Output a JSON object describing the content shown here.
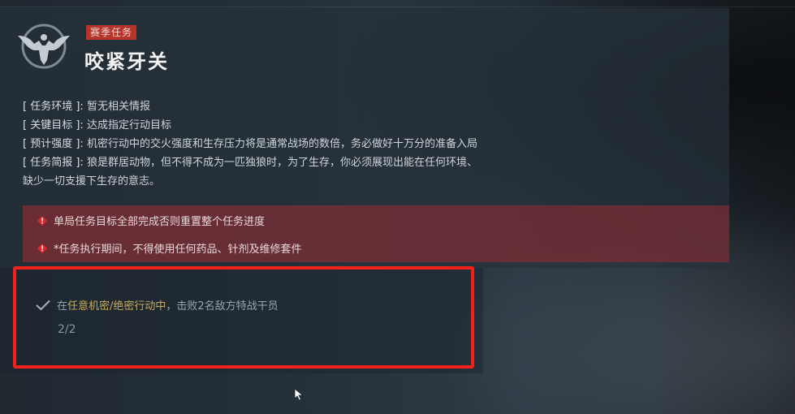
{
  "mission": {
    "tag": "赛季任务",
    "title": "咬紧牙关"
  },
  "info": [
    {
      "label": "[ 任务环境 ]:",
      "value": "暂无相关情报"
    },
    {
      "label": "[ 关键目标 ]:",
      "value": "达成指定行动目标"
    },
    {
      "label": "[ 预计强度 ]:",
      "value": "机密行动中的交火强度和生存压力将是通常战场的数倍，务必做好十万分的准备入局"
    },
    {
      "label": "[ 任务简报 ]:",
      "value": "狼是群居动物，但不得不成为一匹独狼时，为了生存，你必须展现出能在任何环境、"
    },
    {
      "label": "",
      "value": "缺少一切支援下生存的意志。"
    }
  ],
  "warnings": [
    "单局任务目标全部完成否则重置整个任务进度",
    "*任务执行期间，不得使用任何药品、针剂及维修套件"
  ],
  "objective": {
    "prefix": "在",
    "highlight": "任意机密/绝密行动中",
    "suffix": "，击败2名敌方特战干员",
    "progress": "2/2"
  },
  "icons": {
    "emblem": "eagle-emblem-icon",
    "warning": "exclamation-diamond-icon",
    "check": "check-icon",
    "cursor": "mouse-cursor-icon"
  },
  "colors": {
    "tag_bg": "#b7342b",
    "warning_bg": "#7a2d34",
    "highlight": "#c8ab5b",
    "annotation_frame": "#f2221b"
  }
}
